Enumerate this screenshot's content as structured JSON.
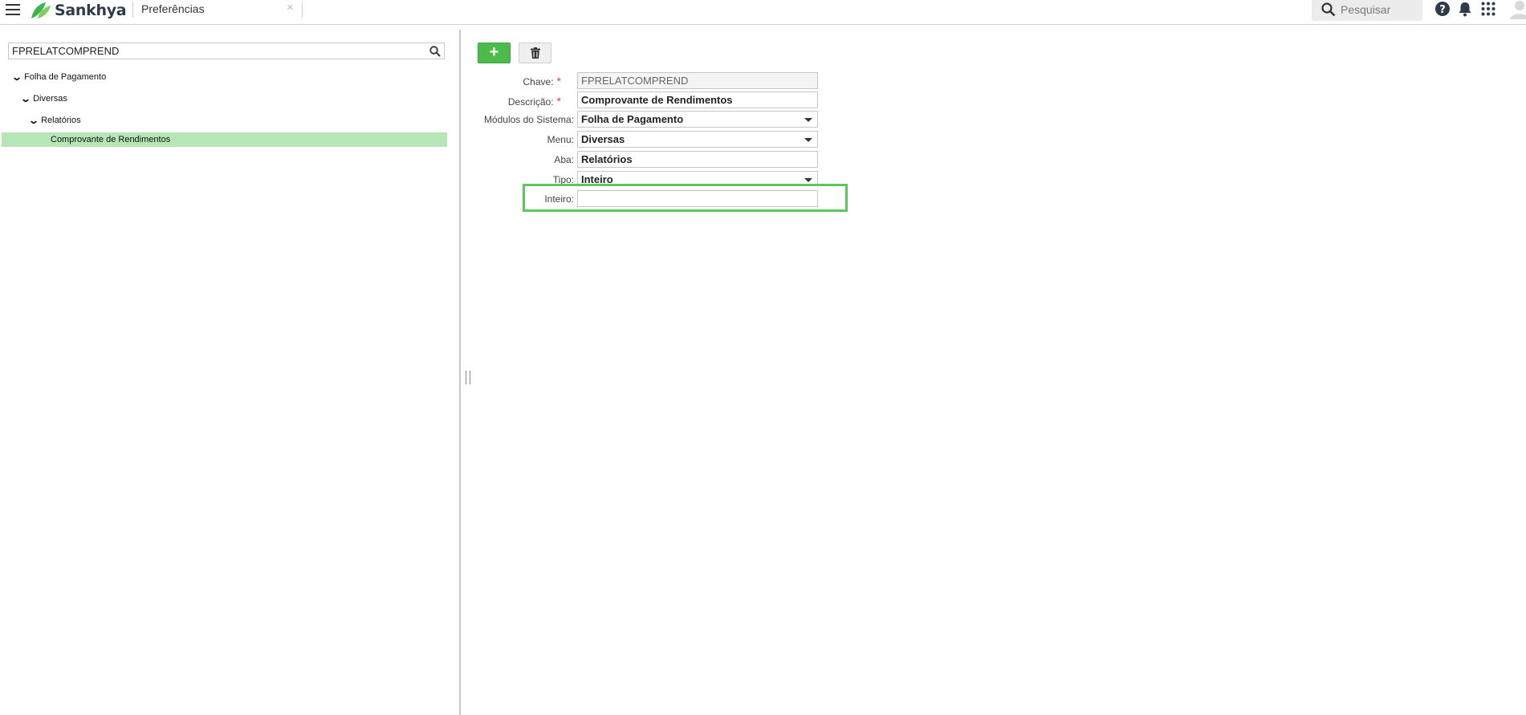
{
  "header": {
    "brand": "Sankhya",
    "tab_title": "Preferências",
    "tab_close": "×",
    "search_placeholder": "Pesquisar",
    "icons": [
      "menu-icon",
      "help-icon",
      "bell-icon",
      "apps-grid-icon",
      "user-avatar"
    ]
  },
  "tree": {
    "filter_value": "FPRELATCOMPREND",
    "nodes": [
      {
        "label": "Folha de Pagamento",
        "level": 0
      },
      {
        "label": "Diversas",
        "level": 1
      },
      {
        "label": "Relatórios",
        "level": 2
      },
      {
        "label": "Comprovante de Rendimentos",
        "level": 3,
        "selected": true
      }
    ]
  },
  "toolbar": {
    "add_label": "+",
    "delete_icon": "trash-icon"
  },
  "form": {
    "chave_label": "Chave:",
    "chave_value": "FPRELATCOMPREND",
    "descricao_label": "Descrição:",
    "descricao_value": "Comprovante de Rendimentos",
    "modulos_label": "Módulos do Sistema:",
    "modulos_value": "Folha de Pagamento",
    "menu_label": "Menu:",
    "menu_value": "Diversas",
    "aba_label": "Aba:",
    "aba_value": "Relatórios",
    "tipo_label": "Tipo:",
    "tipo_value": "Inteiro",
    "inteiro_label": "Inteiro:",
    "inteiro_value": "",
    "required_mark": "*"
  },
  "colors": {
    "accent_green": "#4cbb4c",
    "selected_row": "#b6e6b6",
    "highlight": "#5cc85c",
    "required": "#e23b3b"
  }
}
